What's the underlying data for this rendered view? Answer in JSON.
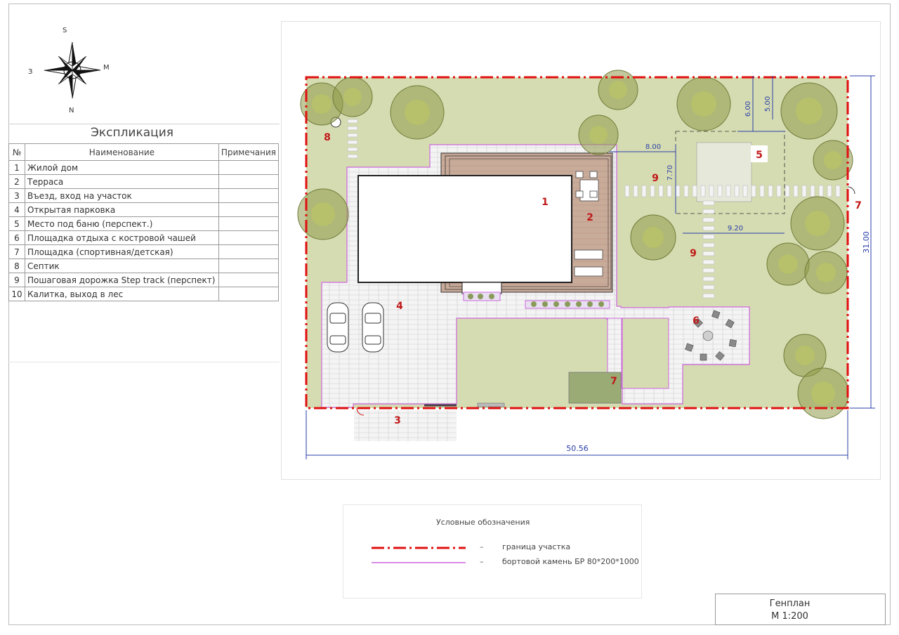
{
  "compass": {
    "north": "N",
    "south": "S",
    "west": "З",
    "east": "M"
  },
  "explication": {
    "title": "Экспликация",
    "headers": {
      "num": "№",
      "name": "Наименование",
      "note": "Примечания"
    },
    "rows": [
      {
        "num": "1",
        "name": "Жилой дом",
        "note": ""
      },
      {
        "num": "2",
        "name": "Терраса",
        "note": ""
      },
      {
        "num": "3",
        "name": "Въезд, вход на участок",
        "note": ""
      },
      {
        "num": "4",
        "name": "Открытая парковка",
        "note": ""
      },
      {
        "num": "5",
        "name": "Место под баню (перспект.)",
        "note": ""
      },
      {
        "num": "6",
        "name": "Площадка отдыха с костровой чашей",
        "note": ""
      },
      {
        "num": "7",
        "name": "Площадка (спортивная/детская)",
        "note": ""
      },
      {
        "num": "8",
        "name": "Септик",
        "note": ""
      },
      {
        "num": "9",
        "name": "Пошаговая дорожка Step track (перспект)",
        "note": ""
      },
      {
        "num": "10",
        "name": "Калитка, выход в лес",
        "note": ""
      }
    ]
  },
  "plan": {
    "labels": {
      "house": "1",
      "terrace": "2",
      "entrance": "3",
      "parking": "4",
      "bath": "5",
      "fire": "6",
      "play_main": "7",
      "play_edge": "7",
      "septic": "8",
      "path_a": "9",
      "path_b": "9"
    },
    "dimensions": {
      "width": "50.56",
      "height": "31.00",
      "bath_w": "8.00",
      "bath_h": "7.70",
      "bath_w2": "9.20",
      "offset_a": "6.00",
      "offset_b": "5.00"
    }
  },
  "legend": {
    "title": "Условные обозначения",
    "dash": "–",
    "items": [
      {
        "text": "граница участка",
        "color": "#e01010"
      },
      {
        "text": "бортовой камень БР 80*200*1000",
        "color": "#cc66dd"
      }
    ]
  },
  "stamp": {
    "title": "Генплан",
    "scale": "М 1:200"
  },
  "colors": {
    "boundary": "#e01010",
    "curb": "#cc66dd",
    "lawn": "#d6dcb2",
    "paving": "#f2f2f2",
    "deck": "#c9ab9a",
    "label": "#c01818",
    "dimension": "#2a3fa8",
    "play": "#9aab76"
  }
}
